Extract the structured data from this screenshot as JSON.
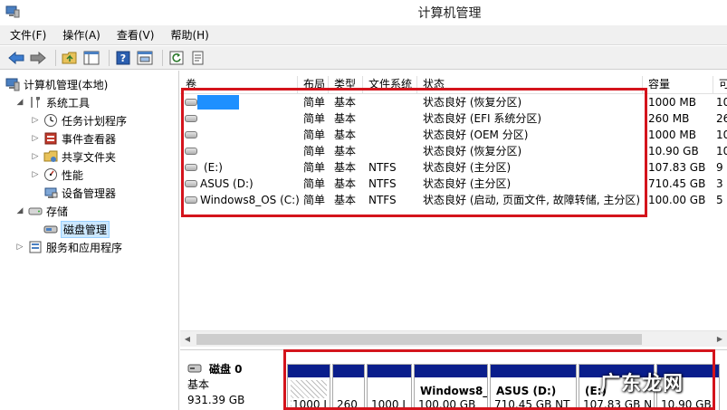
{
  "window": {
    "title": "计算机管理"
  },
  "menu": [
    "文件(F)",
    "操作(A)",
    "查看(V)",
    "帮助(H)"
  ],
  "toolbar": [
    "back-icon",
    "forward-icon",
    "up-folder-icon",
    "console-icon",
    "help-icon",
    "properties-icon",
    "refresh-icon",
    "export-icon"
  ],
  "tree": [
    {
      "label": "计算机管理(本地)",
      "indent": 0,
      "expander": "",
      "icon": "computer-icon"
    },
    {
      "label": "系统工具",
      "indent": 1,
      "expander": "◢",
      "icon": "tools-icon"
    },
    {
      "label": "任务计划程序",
      "indent": 2,
      "expander": "▷",
      "icon": "clock-icon"
    },
    {
      "label": "事件查看器",
      "indent": 2,
      "expander": "▷",
      "icon": "event-viewer-icon"
    },
    {
      "label": "共享文件夹",
      "indent": 2,
      "expander": "▷",
      "icon": "shared-folder-icon"
    },
    {
      "label": "性能",
      "indent": 2,
      "expander": "▷",
      "icon": "performance-icon"
    },
    {
      "label": "设备管理器",
      "indent": 2,
      "expander": "",
      "icon": "device-manager-icon"
    },
    {
      "label": "存储",
      "indent": 1,
      "expander": "◢",
      "icon": "storage-icon"
    },
    {
      "label": "磁盘管理",
      "indent": 2,
      "expander": "",
      "icon": "disk-management-icon",
      "selected": true
    },
    {
      "label": "服务和应用程序",
      "indent": 1,
      "expander": "▷",
      "icon": "services-icon"
    }
  ],
  "volume_columns": [
    "卷",
    "布局",
    "类型",
    "文件系统",
    "状态",
    "容量",
    "可"
  ],
  "volumes": [
    {
      "name": "",
      "hidden_name": true,
      "layout": "简单",
      "type": "基本",
      "fs": "",
      "status": "状态良好 (恢复分区)",
      "capacity": "1000 MB",
      "free": "10"
    },
    {
      "name": "",
      "layout": "简单",
      "type": "基本",
      "fs": "",
      "status": "状态良好 (EFI 系统分区)",
      "capacity": "260 MB",
      "free": "26"
    },
    {
      "name": "",
      "layout": "简单",
      "type": "基本",
      "fs": "",
      "status": "状态良好 (OEM 分区)",
      "capacity": "1000 MB",
      "free": "10"
    },
    {
      "name": "",
      "layout": "简单",
      "type": "基本",
      "fs": "",
      "status": "状态良好 (恢复分区)",
      "capacity": "10.90 GB",
      "free": "10"
    },
    {
      "name": "(E:)",
      "layout": "简单",
      "type": "基本",
      "fs": "NTFS",
      "status": "状态良好 (主分区)",
      "capacity": "107.83 GB",
      "free": "9"
    },
    {
      "name": "ASUS (D:)",
      "layout": "简单",
      "type": "基本",
      "fs": "NTFS",
      "status": "状态良好 (主分区)",
      "capacity": "710.45 GB",
      "free": "3"
    },
    {
      "name": "Windows8_OS (C:)",
      "layout": "简单",
      "type": "基本",
      "fs": "NTFS",
      "status": "状态良好 (启动, 页面文件, 故障转储, 主分区)",
      "capacity": "100.00 GB",
      "free": "5"
    }
  ],
  "disk": {
    "label": "磁盘 0",
    "kind": "基本",
    "size": "931.39 GB",
    "partitions": [
      {
        "name": "",
        "size": "1000 I",
        "hatched": true
      },
      {
        "name": "",
        "size": "260"
      },
      {
        "name": "",
        "size": "1000 I"
      },
      {
        "name": "Windows8_",
        "size": "100.00 GB"
      },
      {
        "name": "ASUS  (D:)",
        "size": "710.45 GB NT"
      },
      {
        "name": "(E:)",
        "size": "107.83 GB N"
      },
      {
        "name": "",
        "size": "10.90 GB"
      }
    ]
  },
  "watermark": "广东龙网",
  "colors": {
    "highlight": "#d4141c",
    "partition_bar": "#0a1e8c",
    "blue_block": "#1e90ff",
    "selection": "#cce8ff"
  }
}
